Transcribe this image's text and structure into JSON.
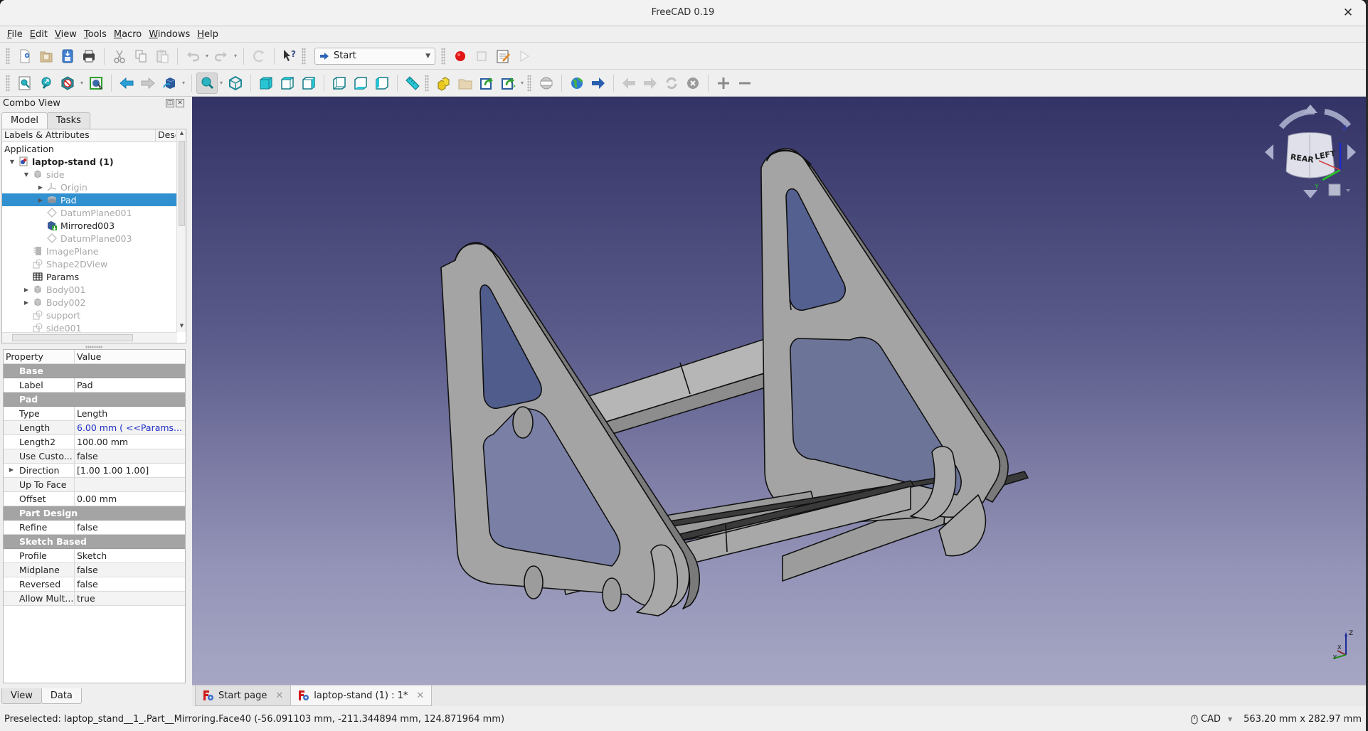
{
  "window": {
    "title": "FreeCAD 0.19"
  },
  "menu": [
    {
      "label": "File",
      "ul": "F",
      "rest": "ile"
    },
    {
      "label": "Edit",
      "ul": "E",
      "rest": "dit"
    },
    {
      "label": "View",
      "ul": "V",
      "rest": "iew"
    },
    {
      "label": "Tools",
      "ul": "T",
      "rest": "ools"
    },
    {
      "label": "Macro",
      "ul": "M",
      "rest": "acro"
    },
    {
      "label": "Windows",
      "ul": "W",
      "rest": "indows"
    },
    {
      "label": "Help",
      "ul": "H",
      "rest": "elp"
    }
  ],
  "toolbar1": {
    "workbench": "Start",
    "icons": [
      "new-document-icon",
      "open-icon",
      "save-icon",
      "print-icon",
      "cut-icon",
      "copy-icon",
      "paste-icon",
      "undo-icon",
      "redo-icon",
      "refresh-icon",
      "whats-this-icon",
      "macro-record-icon",
      "macro-stop-icon",
      "macro-edit-icon",
      "macro-run-icon"
    ]
  },
  "toolbar2": {
    "icons": [
      "fit-all-icon",
      "fit-selection-icon",
      "draw-style-icon",
      "bounding-box-icon",
      "back-icon",
      "forward-icon",
      "std-views-icon",
      "isometric-icon",
      "axonometric-icon",
      "front-icon",
      "top-icon",
      "right-icon",
      "rear-icon",
      "bottom-icon",
      "left-icon",
      "measure-icon",
      "part-icon",
      "group-icon",
      "link-icon",
      "link-actions-icon",
      "clipping-icon",
      "web-icon",
      "web-forward-icon",
      "web-back-icon",
      "web-forward2-icon",
      "web-refresh-icon",
      "web-stop-icon",
      "zoom-in-icon",
      "zoom-out-icon"
    ]
  },
  "combo": {
    "title": "Combo View",
    "tabs": [
      "Model",
      "Tasks"
    ],
    "active_tab": "Model",
    "tree_header": {
      "col1": "Labels & Attributes",
      "col2": "Desc"
    },
    "tree": [
      {
        "label": "Application",
        "indent": 0,
        "expander": "",
        "icon": "",
        "style": "normal"
      },
      {
        "label": "laptop-stand (1)",
        "indent": 1,
        "expander": "open",
        "icon": "document-icon",
        "style": "bold"
      },
      {
        "label": "side",
        "indent": 2,
        "expander": "open",
        "icon": "body-icon",
        "style": "dim"
      },
      {
        "label": "Origin",
        "indent": 3,
        "expander": "closed",
        "icon": "origin-icon",
        "style": "dim"
      },
      {
        "label": "Pad",
        "indent": 3,
        "expander": "closed",
        "icon": "pad-icon",
        "style": "selected"
      },
      {
        "label": "DatumPlane001",
        "indent": 3,
        "expander": "",
        "icon": "datum-plane-icon",
        "style": "dim"
      },
      {
        "label": "Mirrored003",
        "indent": 3,
        "expander": "",
        "icon": "mirrored-icon",
        "style": "normal"
      },
      {
        "label": "DatumPlane003",
        "indent": 3,
        "expander": "",
        "icon": "datum-plane-icon",
        "style": "dim"
      },
      {
        "label": "ImagePlane",
        "indent": 2,
        "expander": "",
        "icon": "image-plane-icon",
        "style": "dim"
      },
      {
        "label": "Shape2DView",
        "indent": 2,
        "expander": "",
        "icon": "shape2dview-icon",
        "style": "dim"
      },
      {
        "label": "Params",
        "indent": 2,
        "expander": "",
        "icon": "spreadsheet-icon",
        "style": "normal"
      },
      {
        "label": "Body001",
        "indent": 2,
        "expander": "closed",
        "icon": "body-icon",
        "style": "dim"
      },
      {
        "label": "Body002",
        "indent": 2,
        "expander": "closed",
        "icon": "body-icon",
        "style": "dim"
      },
      {
        "label": "support",
        "indent": 2,
        "expander": "",
        "icon": "shape2dview-icon",
        "style": "dim"
      },
      {
        "label": "side001",
        "indent": 2,
        "expander": "",
        "icon": "shape2dview-icon",
        "style": "dim"
      }
    ],
    "props_header": {
      "property": "Property",
      "value": "Value"
    },
    "properties": [
      {
        "group": "Base"
      },
      {
        "key": "Label",
        "value": "Pad"
      },
      {
        "group": "Pad"
      },
      {
        "key": "Type",
        "value": "Length"
      },
      {
        "key": "Length",
        "value": "6.00 mm  ( <<Params...",
        "expr": true
      },
      {
        "key": "Length2",
        "value": "100.00 mm"
      },
      {
        "key": "Use Custo...",
        "value": "false"
      },
      {
        "key": "Direction",
        "value": "[1.00 1.00 1.00]",
        "expandable": true
      },
      {
        "key": "Up To Face",
        "value": ""
      },
      {
        "key": "Offset",
        "value": "0.00 mm"
      },
      {
        "group": "Part Design"
      },
      {
        "key": "Refine",
        "value": "false"
      },
      {
        "group": "Sketch Based"
      },
      {
        "key": "Profile",
        "value": "Sketch"
      },
      {
        "key": "Midplane",
        "value": "false"
      },
      {
        "key": "Reversed",
        "value": "false"
      },
      {
        "key": "Allow Mult...",
        "value": "true"
      }
    ],
    "bottom_tabs": [
      "View",
      "Data"
    ],
    "active_bottom_tab": "Data"
  },
  "viewport": {
    "navcube": {
      "faces": [
        "REAR",
        "LEFT"
      ],
      "axes": [
        "X",
        "Y",
        "Z"
      ]
    },
    "axis_cross": [
      "X",
      "Y",
      "Z"
    ]
  },
  "doc_tabs": [
    {
      "label": "Start page",
      "active": false
    },
    {
      "label": "laptop-stand (1) : 1*",
      "active": true
    }
  ],
  "status": {
    "message": "Preselected: laptop_stand__1_.Part__Mirroring.Face40 (-56.091103 mm, -211.344894 mm, 124.871964 mm)",
    "nav_style": "CAD",
    "dimensions": "563.20 mm x 282.97 mm"
  }
}
